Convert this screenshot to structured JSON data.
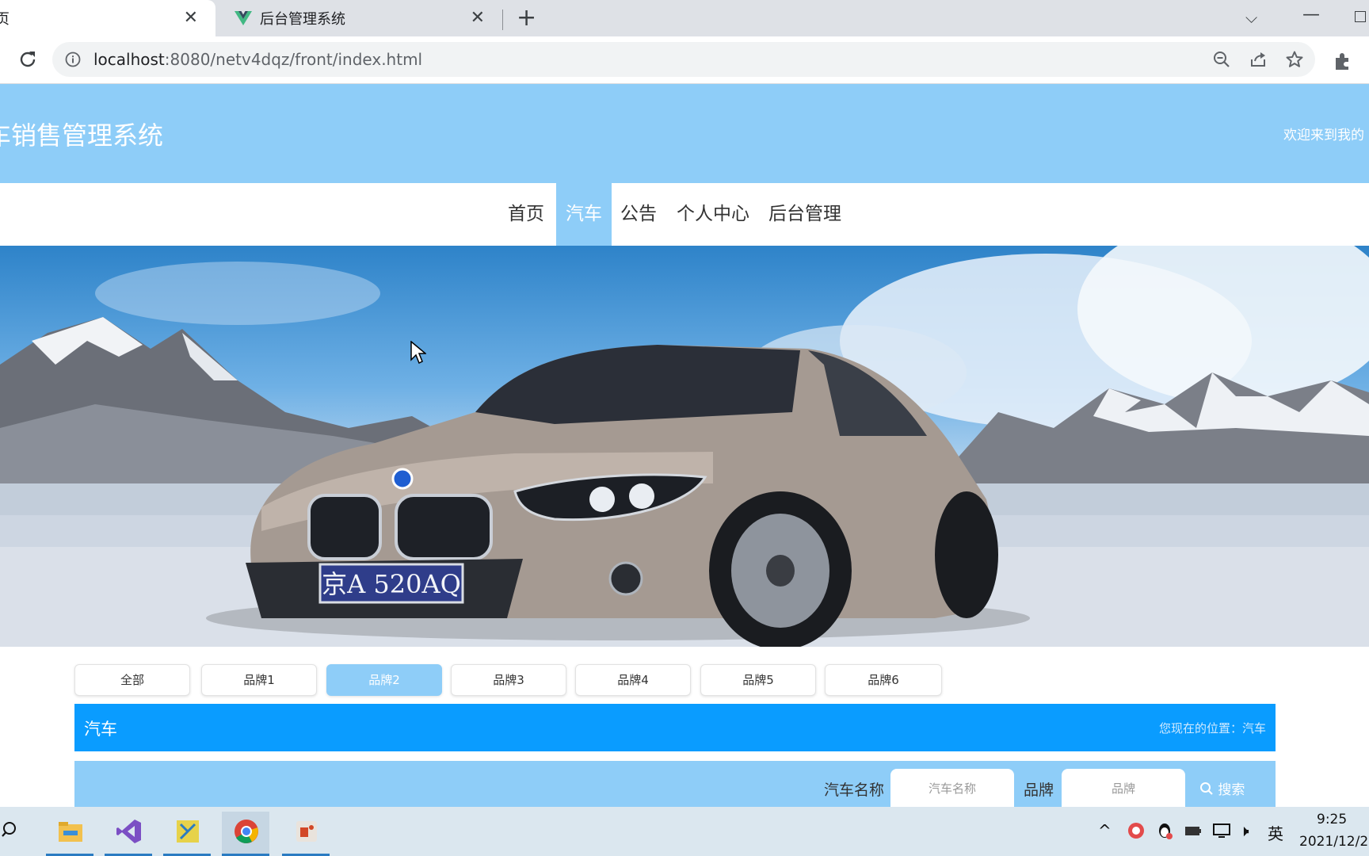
{
  "browser": {
    "tabs": [
      {
        "title": "页",
        "active": true
      },
      {
        "title": "后台管理系统",
        "active": false
      }
    ],
    "close_glyph": "✕",
    "new_tab_glyph": "+",
    "dropdown_glyph": "⌵",
    "minimize_glyph": "—",
    "address": {
      "host": "localhost",
      "rest": ":8080/netv4dqz/front/index.html"
    },
    "icons": [
      "reload-icon",
      "info-icon",
      "zoom-out-icon",
      "share-icon",
      "bookmark-star-icon",
      "extensions-icon"
    ]
  },
  "header": {
    "title": "车销售管理系统",
    "welcome": "欢迎来到我的"
  },
  "nav": {
    "items": [
      "首页",
      "汽车",
      "公告",
      "个人中心",
      "后台管理"
    ],
    "active_index": 1
  },
  "banner": {
    "plate": "京A 520AQ",
    "image": "silver-hatchback-car-mountain-scene"
  },
  "categories": {
    "items": [
      "全部",
      "品牌1",
      "品牌2",
      "品牌3",
      "品牌4",
      "品牌5",
      "品牌6"
    ],
    "active_index": 2
  },
  "section": {
    "title": "汽车",
    "breadcrumb": "您现在的位置：汽车"
  },
  "search": {
    "name_label": "汽车名称",
    "name_placeholder": "汽车名称",
    "brand_label": "品牌",
    "brand_placeholder": "品牌",
    "button": "搜索"
  },
  "taskbar": {
    "apps": [
      "file-explorer-icon",
      "visual-studio-icon",
      "dev-tool-icon",
      "chrome-icon",
      "powerpoint-icon"
    ],
    "tray": {
      "chevron": "^",
      "speaker": "🕨",
      "ime": "英"
    },
    "time": "9:25",
    "date": "2021/12/2"
  },
  "colors": {
    "header_bg": "#8ecdf8",
    "section_bg": "#0a9cff",
    "accent": "#8ecdf8"
  }
}
